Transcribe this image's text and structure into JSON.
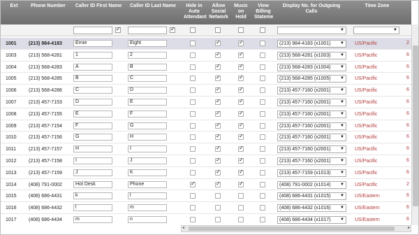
{
  "columns": {
    "ext": "Ext",
    "phone": "Phone Number",
    "first": "Caller ID First Name",
    "last": "Caller ID Last Name",
    "hide": "Hide in Auto Attendant",
    "social": "Allow Social Network",
    "hold": "Music on Hold",
    "billing": "View Billing Stateme",
    "display": "Display No. for Outgoing Calls",
    "tz": "Time Zone"
  },
  "filter": {
    "first_value": "",
    "last_value": "",
    "display_value": "",
    "tz_value": ""
  },
  "colors": {
    "header_bg": "#7f7f7f",
    "selected_row": "#dcdde6",
    "timezone_text": "#b23a3a"
  },
  "rows": [
    {
      "ext": "1001",
      "phone": "(213) 984-4183",
      "first": "Ernie",
      "last": "Eight",
      "hide": false,
      "social": true,
      "hold": true,
      "billing": false,
      "display": "(213) 984-4183 (x1001)",
      "tz": "US/Pacific",
      "edge": "2"
    },
    {
      "ext": "1003",
      "phone": "(213) 568-4281",
      "first": "1",
      "last": "2",
      "hide": false,
      "social": true,
      "hold": true,
      "billing": false,
      "display": "(213) 568-4281 (x1003)",
      "tz": "US/Pacific",
      "edge": "6"
    },
    {
      "ext": "1004",
      "phone": "(213) 568-4283",
      "first": "A",
      "last": "B",
      "hide": false,
      "social": true,
      "hold": true,
      "billing": false,
      "display": "(213) 568-4283 (x1004)",
      "tz": "US/Pacific",
      "edge": "6"
    },
    {
      "ext": "1005",
      "phone": "(213) 568-4285",
      "first": "B",
      "last": "C",
      "hide": false,
      "social": true,
      "hold": true,
      "billing": false,
      "display": "(213) 568-4285 (x1005)",
      "tz": "US/Pacific",
      "edge": "6"
    },
    {
      "ext": "1006",
      "phone": "(213) 568-4286",
      "first": "C",
      "last": "D",
      "hide": false,
      "social": true,
      "hold": true,
      "billing": false,
      "display": "(213) 457-7160 (x2001)",
      "tz": "US/Pacific",
      "edge": "6"
    },
    {
      "ext": "1007",
      "phone": "(213) 457-7153",
      "first": "D",
      "last": "E",
      "hide": false,
      "social": true,
      "hold": true,
      "billing": false,
      "display": "(213) 457-7160 (x2001)",
      "tz": "US/Pacific",
      "edge": "6"
    },
    {
      "ext": "1008",
      "phone": "(213) 457-7155",
      "first": "E",
      "last": "F",
      "hide": false,
      "social": true,
      "hold": true,
      "billing": false,
      "display": "(213) 457-7160 (x2001)",
      "tz": "US/Pacific",
      "edge": "6"
    },
    {
      "ext": "1009",
      "phone": "(213) 457-7154",
      "first": "F",
      "last": "G",
      "hide": false,
      "social": true,
      "hold": true,
      "billing": false,
      "display": "(213) 457-7160 (x2001)",
      "tz": "US/Pacific",
      "edge": "6"
    },
    {
      "ext": "1010",
      "phone": "(213) 457-7156",
      "first": "G",
      "last": "H",
      "hide": false,
      "social": true,
      "hold": true,
      "billing": false,
      "display": "(213) 457-7160 (x2001)",
      "tz": "US/Pacific",
      "edge": "6"
    },
    {
      "ext": "1011",
      "phone": "(213) 457-7157",
      "first": "H",
      "last": "I",
      "hide": false,
      "social": true,
      "hold": true,
      "billing": false,
      "display": "(213) 457-7160 (x2001)",
      "tz": "US/Pacific",
      "edge": "6"
    },
    {
      "ext": "1012",
      "phone": "(213) 457-7158",
      "first": "I",
      "last": "J",
      "hide": false,
      "social": true,
      "hold": true,
      "billing": false,
      "display": "(213) 457-7160 (x2001)",
      "tz": "US/Pacific",
      "edge": "6"
    },
    {
      "ext": "1013",
      "phone": "(213) 457-7159",
      "first": "J",
      "last": "K",
      "hide": false,
      "social": true,
      "hold": true,
      "billing": false,
      "display": "(213) 457-7159 (x1013)",
      "tz": "US/Pacific",
      "edge": "6"
    },
    {
      "ext": "1014",
      "phone": "(408) 791-0002",
      "first": "Hot Desk",
      "last": "Phone",
      "hide": true,
      "social": true,
      "hold": true,
      "billing": false,
      "display": "(408) 791-0002 (x1014)",
      "tz": "US/Pacific",
      "edge": "2"
    },
    {
      "ext": "1015",
      "phone": "(408) 686-4431",
      "first": "k",
      "last": "l",
      "hide": false,
      "social": false,
      "hold": false,
      "billing": false,
      "display": "(408) 686-4431 (x1015)",
      "tz": "US/Eastern",
      "edge": "6"
    },
    {
      "ext": "1016",
      "phone": "(408) 686-4432",
      "first": "l",
      "last": "m",
      "hide": false,
      "social": false,
      "hold": false,
      "billing": false,
      "display": "(408) 686-4432 (x1016)",
      "tz": "US/Eastern",
      "edge": "6"
    },
    {
      "ext": "1017",
      "phone": "(408) 686-4434",
      "first": "m",
      "last": "n",
      "hide": false,
      "social": false,
      "hold": false,
      "billing": false,
      "display": "(408) 686-4434 (x1017)",
      "tz": "US/Eastern",
      "edge": "6"
    }
  ]
}
